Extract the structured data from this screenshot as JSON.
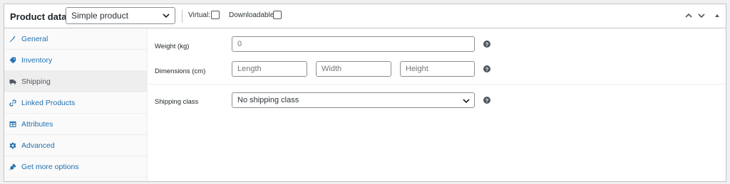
{
  "header": {
    "title": "Product data —",
    "product_type": "Simple product",
    "virtual_label": "Virtual:",
    "downloadable_label": "Downloadable:"
  },
  "sidebar": {
    "items": [
      {
        "label": "General",
        "icon": "wrench-icon",
        "active": false
      },
      {
        "label": "Inventory",
        "icon": "tag-icon",
        "active": false
      },
      {
        "label": "Shipping",
        "icon": "truck-icon",
        "active": true
      },
      {
        "label": "Linked Products",
        "icon": "link-icon",
        "active": false
      },
      {
        "label": "Attributes",
        "icon": "table-icon",
        "active": false
      },
      {
        "label": "Advanced",
        "icon": "gear-icon",
        "active": false
      },
      {
        "label": "Get more options",
        "icon": "plugin-icon",
        "active": false
      }
    ]
  },
  "shipping": {
    "weight_label": "Weight (kg)",
    "weight_placeholder": "0",
    "dimensions_label": "Dimensions (cm)",
    "length_placeholder": "Length",
    "width_placeholder": "Width",
    "height_placeholder": "Height",
    "class_label": "Shipping class",
    "class_value": "No shipping class"
  },
  "colors": {
    "link": "#2271b1",
    "border": "#c3c4c7",
    "active_tab_bg": "#eeeeee"
  }
}
